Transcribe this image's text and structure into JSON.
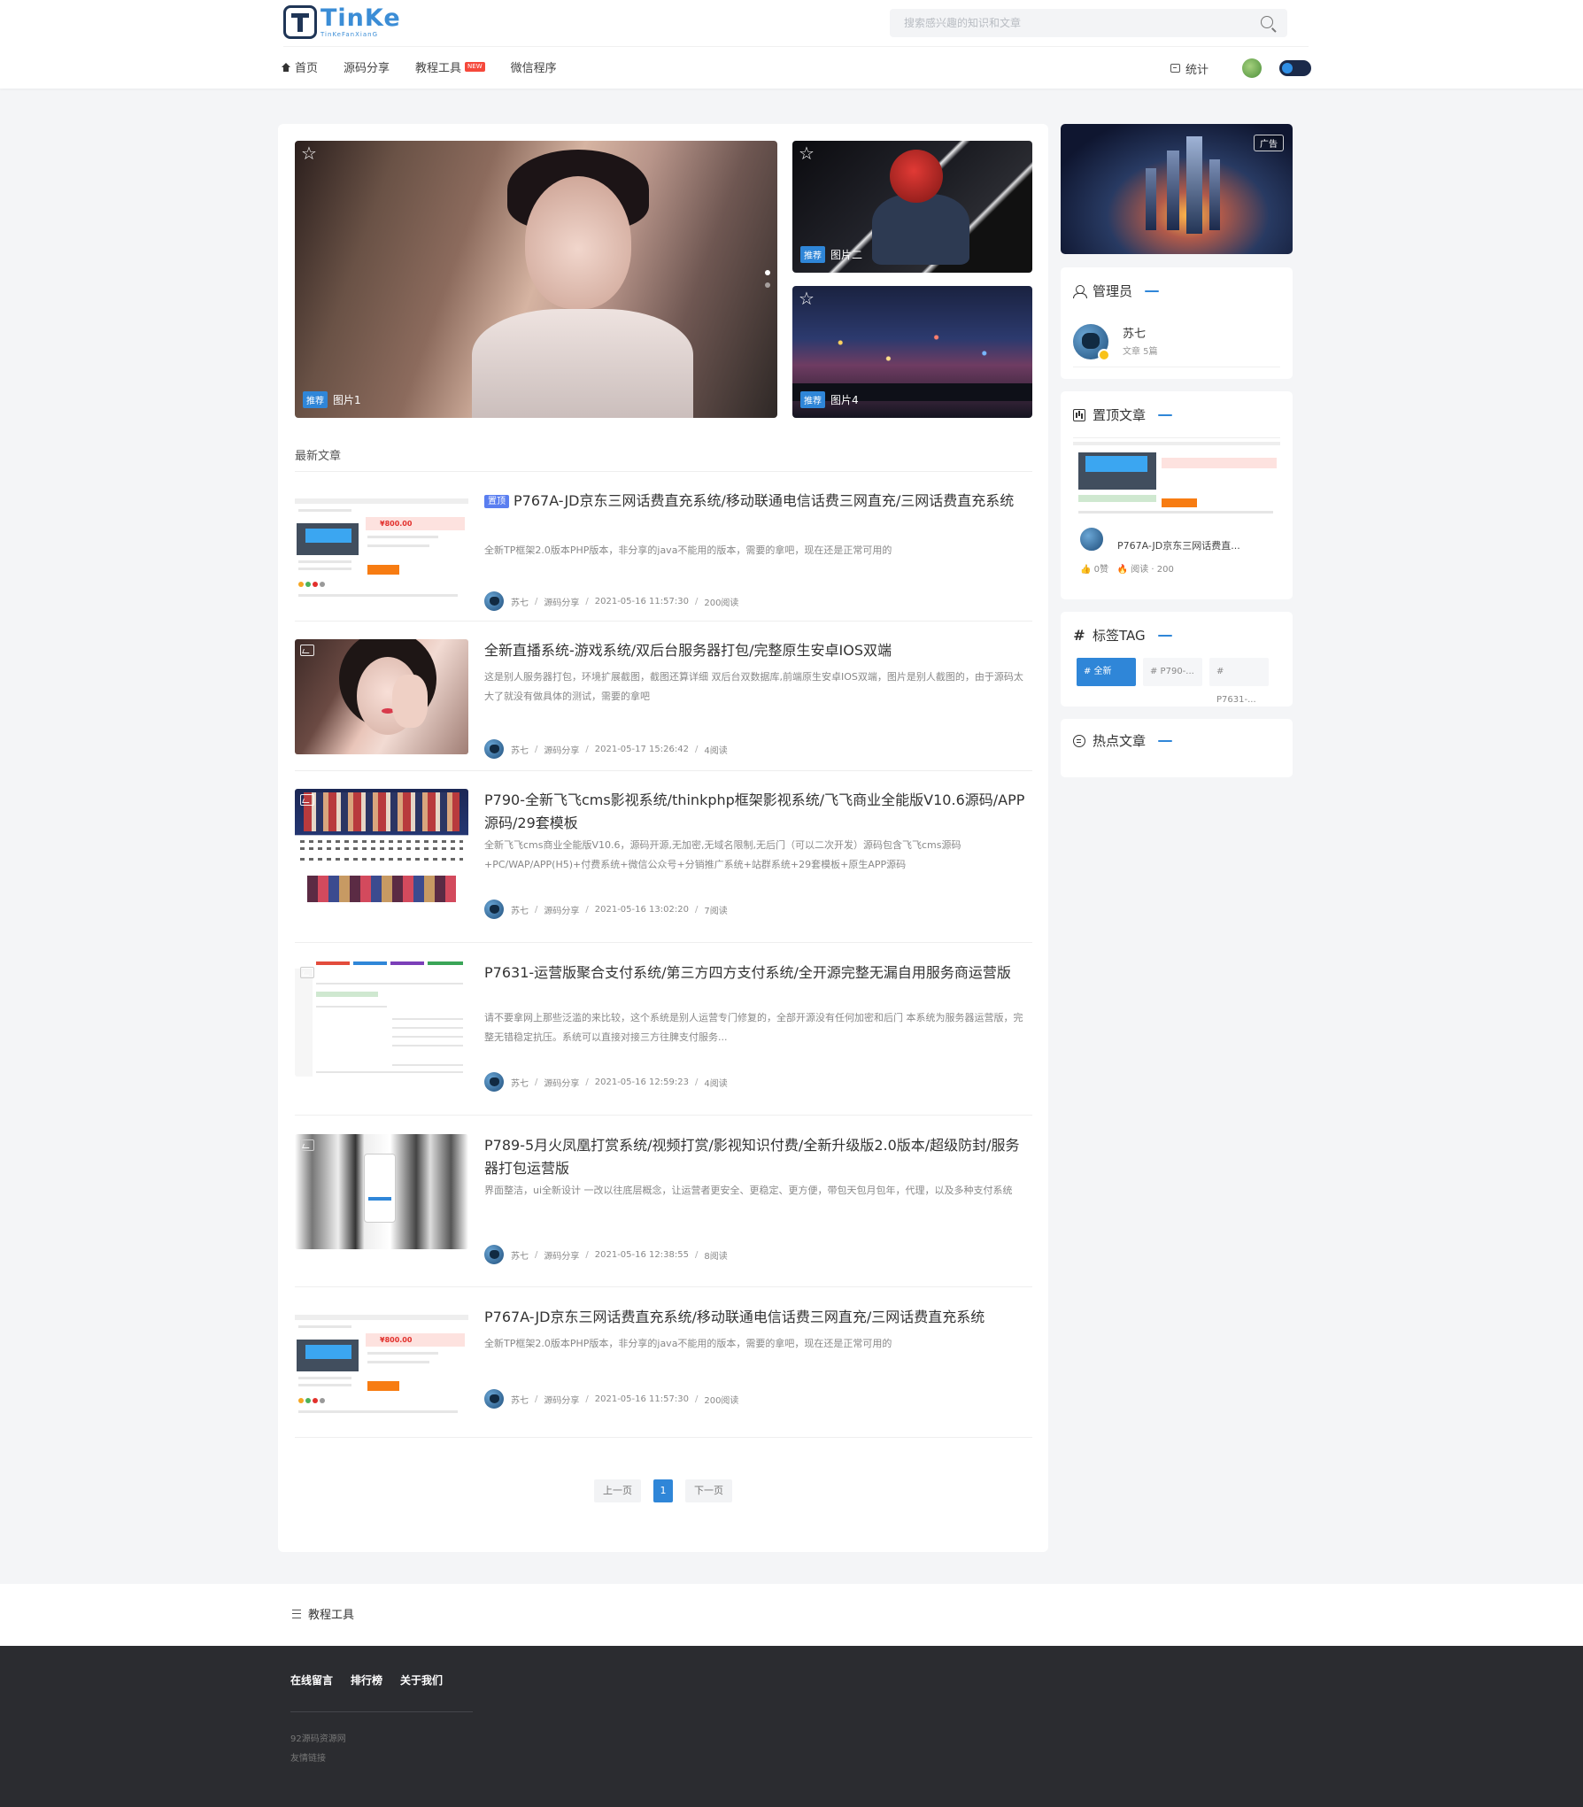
{
  "header": {
    "logo_title": "TinKe",
    "logo_sub": "TinKeFanXianG",
    "search_placeholder": "搜索感兴趣的知识和文章",
    "nav": [
      {
        "label": "首页",
        "icon": "home-icon"
      },
      {
        "label": "源码分享"
      },
      {
        "label": "教程工具",
        "badge": "NEW"
      },
      {
        "label": "微信程序"
      }
    ],
    "stats_label": "统计"
  },
  "slider": {
    "big": {
      "tag": "推荐",
      "label": "图片1"
    },
    "top_right": {
      "tag": "推荐",
      "label": "图片二"
    },
    "bottom_right": {
      "tag": "推荐",
      "label": "图片4"
    }
  },
  "latest": {
    "title": "最新文章",
    "posts": [
      {
        "top_tag": "置顶",
        "title": "P767A-JD京东三网话费直充系统/移动联通电信话费三网直充/三网话费直充系统",
        "desc": "全新TP框架2.0版本PHP版本，非分享的java不能用的版本，需要的拿吧，现在还是正常可用的",
        "author": "苏七",
        "category": "源码分享",
        "date": "2021-05-16 11:57:30",
        "views": "200阅读"
      },
      {
        "title": "全新直播系统-游戏系统/双后台服务器打包/完整原生安卓IOS双端",
        "desc": "这是别人服务器打包，环境扩展截图，截图还算详细 双后台双数据库,前端原生安卓IOS双端，图片是别人截图的，由于源码太大了就没有做具体的测试，需要的拿吧",
        "author": "苏七",
        "category": "源码分享",
        "date": "2021-05-17 15:26:42",
        "views": "4阅读"
      },
      {
        "title": "P790-全新飞飞cms影视系统/thinkphp框架影视系统/飞飞商业全能版V10.6源码/APP源码/29套模板",
        "desc": "全新飞飞cms商业全能版V10.6，源码开源,无加密,无域名限制,无后门（可以二次开发）源码包含飞飞cms源码+PC/WAP/APP(H5)+付费系统+微信公众号+分销推广系统+站群系统+29套模板+原生APP源码",
        "author": "苏七",
        "category": "源码分享",
        "date": "2021-05-16 13:02:20",
        "views": "7阅读"
      },
      {
        "title": "P7631-运营版聚合支付系统/第三方四方支付系统/全开源完整无漏自用服务商运营版",
        "desc": "请不要拿网上那些泛滥的来比较，这个系统是别人运营专门修复的，全部开源没有任何加密和后门 本系统为服务器运营版，完整无错稳定抗压。系统可以直接对接三方往脾支付服务...",
        "author": "苏七",
        "category": "源码分享",
        "date": "2021-05-16 12:59:23",
        "views": "4阅读"
      },
      {
        "title": "P789-5月火凤凰打赏系统/视频打赏/影视知识付费/全新升级版2.0版本/超级防封/服务器打包运营版",
        "desc": "界面整洁，ui全新设计 一改以往底层概念，让运营者更安全、更稳定、更方便，带包天包月包年，代理，以及多种支付系统",
        "author": "苏七",
        "category": "源码分享",
        "date": "2021-05-16 12:38:55",
        "views": "8阅读"
      },
      {
        "title": "P767A-JD京东三网话费直充系统/移动联通电信话费三网直充/三网话费直充系统",
        "desc": "全新TP框架2.0版本PHP版本，非分享的java不能用的版本，需要的拿吧，现在还是正常可用的",
        "author": "苏七",
        "category": "源码分享",
        "date": "2021-05-16 11:57:30",
        "views": "200阅读"
      }
    ],
    "thumb_price": "¥800.00"
  },
  "pagination": {
    "prev": "上一页",
    "current": "1",
    "next": "下一页"
  },
  "sidebar": {
    "ad_label": "广告",
    "admin": {
      "title": "管理员",
      "name": "苏七",
      "count": "文章 5篇"
    },
    "top_posts": {
      "title": "置顶文章",
      "item_title": "P767A-JD京东三网话费直...",
      "meta_likes": "0赞",
      "meta_views": "阅读 · 200"
    },
    "tags": {
      "title": "标签TAG",
      "items": [
        "# 全新直...",
        "# P790-...",
        "# P7631-..."
      ]
    },
    "hot": {
      "title": "热点文章"
    }
  },
  "footer": {
    "menu_label": "教程工具",
    "links": [
      "在线留言",
      "排行榜",
      "关于我们"
    ],
    "site": "92源码资源网",
    "friend_links": "友情链接"
  },
  "colors": {
    "accent": "#2f86d8",
    "footer_bg": "#2b2c30",
    "page_bg": "#f4f5f7"
  }
}
